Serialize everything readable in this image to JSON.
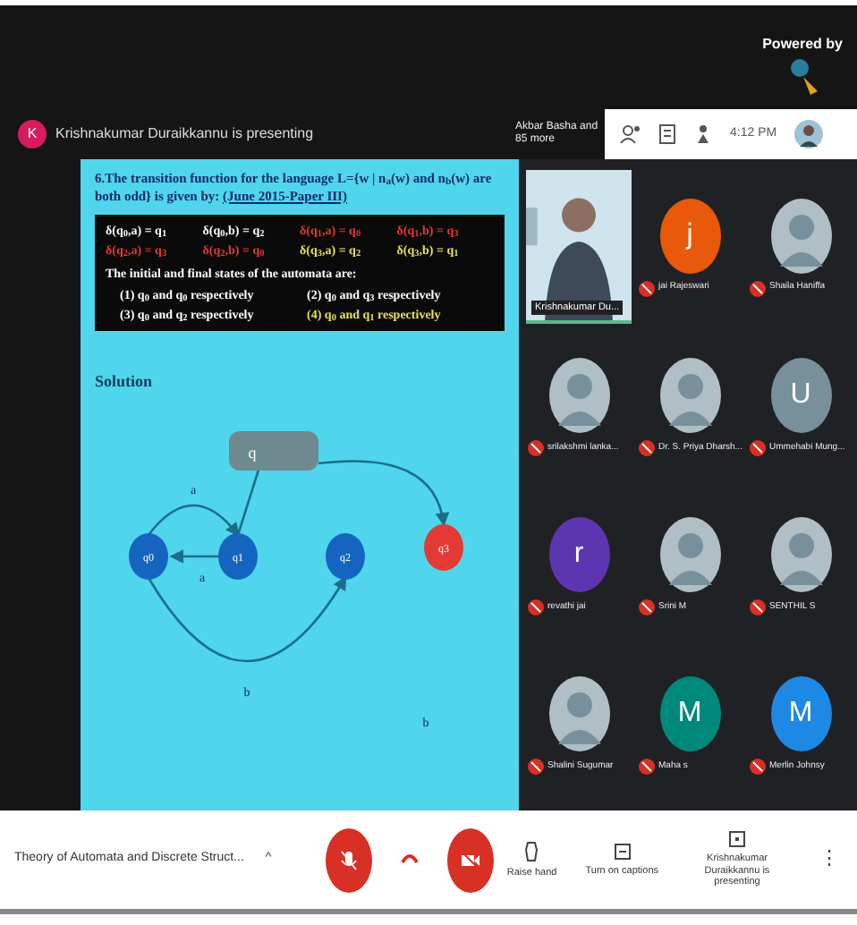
{
  "top_banner": {
    "powered_by": "Powered by"
  },
  "presenter_bar": {
    "avatar_letter": "K",
    "text": "Krishnakumar Duraikkannu is presenting"
  },
  "toolbar": {
    "participants_summary": "Akbar Basha and 85 more",
    "time": "4:12 PM"
  },
  "slide": {
    "question": "6.The transition function for the language L={w | n$_{a}$(w) and n$_{b}$(w) are both odd} is given by:",
    "source": "(June 2015-Paper III)",
    "equations": [
      {
        "text": "δ(q$_{0}$,a) = q$_{1}$",
        "color": "#ffffff"
      },
      {
        "text": "δ(q$_{0}$,b) = q$_{2}$",
        "color": "#ffffff"
      },
      {
        "text": "δ(q$_{1}$,a) = q$_{0}$",
        "color": "#e53935"
      },
      {
        "text": "δ(q$_{1}$,b) = q$_{3}$",
        "color": "#e53935"
      },
      {
        "text": "δ(q$_{2}$,a) = q$_{3}$",
        "color": "#e53935"
      },
      {
        "text": "δ(q$_{2}$,b) = q$_{0}$",
        "color": "#e53935"
      },
      {
        "text": "δ(q$_{3}$,a) = q$_{2}$",
        "color": "#e8e05a"
      },
      {
        "text": "δ(q$_{3}$,b) = q$_{1}$",
        "color": "#e8e05a"
      }
    ],
    "prompt": "The initial and final states of the automata are:",
    "options": [
      {
        "text": "(1) q$_{0}$ and q$_{0}$ respectively",
        "color": "#ffffff"
      },
      {
        "text": "(2) q$_{0}$ and q$_{3}$ respectively",
        "color": "#ffffff"
      },
      {
        "text": "(3) q$_{0}$ and q$_{2}$ respectively",
        "color": "#ffffff"
      },
      {
        "text": "(4) q$_{0}$ and q$_{1}$ respectively",
        "color": "#e8e05a"
      }
    ],
    "solution_label": "Solution",
    "diagram": {
      "nodes": [
        {
          "label": "q0",
          "color": "#1565c0"
        },
        {
          "label": "q1",
          "color": "#1565c0"
        },
        {
          "label": "q2",
          "color": "#1565c0"
        },
        {
          "label": "q3",
          "color": "#e53935"
        }
      ],
      "edge_labels": [
        "a",
        "a",
        "b",
        "b"
      ],
      "box_label": "q"
    }
  },
  "participants": [
    {
      "name": "Krishnakumar Du...",
      "kind": "video"
    },
    {
      "name": "jai Rajeswari",
      "kind": "letter",
      "letter": "j",
      "color": "#e8590c",
      "muted": true
    },
    {
      "name": "Shaila Haniffa",
      "muted": true
    },
    {
      "name": "srilakshmi lanka...",
      "muted": true
    },
    {
      "name": "Dr. S. Priya Dharsh...",
      "muted": true
    },
    {
      "name": "Ummehabi Mung...",
      "kind": "letter",
      "letter": "U",
      "color": "#78909c",
      "muted": true
    },
    {
      "name": "revathi jai",
      "kind": "letter",
      "letter": "r",
      "color": "#5e35b1",
      "muted": true
    },
    {
      "name": "Srini M",
      "muted": true
    },
    {
      "name": "SENTHIL S",
      "muted": true
    },
    {
      "name": "Shalini Sugumar",
      "muted": true
    },
    {
      "name": "Maha s",
      "kind": "letter",
      "letter": "M",
      "color": "#00897b",
      "muted": true
    },
    {
      "name": "Merlin Johnsy",
      "kind": "letter",
      "letter": "M",
      "color": "#1e88e5",
      "muted": true
    }
  ],
  "bottom_bar": {
    "meeting_title": "Theory of Automata and Discrete Struct...",
    "caret": "^",
    "raise_hand": "Raise hand",
    "captions": "Turn on captions",
    "presenting": "Krishnakumar Duraikkannu is presenting",
    "more": "⋮",
    "mic_off": true,
    "camera_off": true
  }
}
